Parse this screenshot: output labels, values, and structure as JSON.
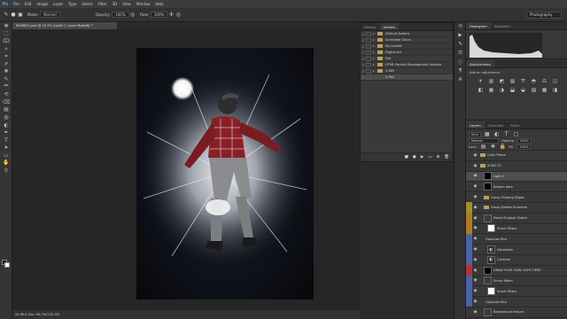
{
  "app": {
    "logo": "Ps"
  },
  "menu": [
    "File",
    "Edit",
    "Image",
    "Layer",
    "Type",
    "Select",
    "Filter",
    "3D",
    "View",
    "Window",
    "Help"
  ],
  "options": {
    "mode_label": "Mode:",
    "mode_value": "Normal",
    "opacity_label": "Opacity:",
    "opacity_value": "100%",
    "flow_label": "Flow:",
    "flow_value": "100%",
    "workspace": "Photography"
  },
  "document": {
    "tab_title": "8349621.psd @ 24.7% (Light 2, Layer Mask/8) *",
    "status": "24.69%   Doc: 66.7M/135.5M"
  },
  "actions_panel": {
    "tabs": [
      "History",
      "Actions"
    ],
    "rows": [
      {
        "check": "✓",
        "label": "Default Actions",
        "selected": false,
        "type": "folder"
      },
      {
        "check": "✓",
        "label": "Animated Glitch",
        "selected": false,
        "type": "folder"
      },
      {
        "check": "✓",
        "label": "My bundle",
        "selected": false,
        "type": "folder"
      },
      {
        "check": "✓",
        "label": "Digital Art",
        "selected": false,
        "type": "folder"
      },
      {
        "check": "✓",
        "label": "Fire",
        "selected": false,
        "type": "folder"
      },
      {
        "check": "✓",
        "label": "HTML Portals Development Actions",
        "selected": false,
        "type": "folder"
      },
      {
        "check": "✓",
        "label": "X-RAY",
        "selected": false,
        "type": "folder"
      },
      {
        "check": "✓",
        "label": "X-Ray",
        "selected": true,
        "type": "action"
      }
    ]
  },
  "right_panels": {
    "histogram_tabs": [
      "Histogram",
      "Navigator"
    ],
    "adjustments_title": "Adjustments",
    "adjustments_hint": "Add an adjustment",
    "layers_tabs": [
      "Layers",
      "Channels",
      "Paths"
    ],
    "kind_label": "Kind",
    "blend_mode": "Normal",
    "opacity_label": "Opacity:",
    "opacity_value": "100%",
    "lock_label": "Lock:",
    "fill_label": "Fill:",
    "fill_value": "100%"
  },
  "layers": [
    {
      "name": "Color Filters",
      "band": "",
      "thumb": "folder",
      "selected": false,
      "indent": 0
    },
    {
      "name": "X-RAY FX",
      "band": "",
      "thumb": "folder",
      "selected": false,
      "indent": 0
    },
    {
      "name": "Light 2",
      "band": "",
      "thumb": "black",
      "selected": true,
      "indent": 1
    },
    {
      "name": "Bottom dark",
      "band": "",
      "thumb": "black",
      "selected": false,
      "indent": 1
    },
    {
      "name": "Group Glowing Edges",
      "band": "",
      "thumb": "folder",
      "selected": false,
      "indent": 1
    },
    {
      "name": "Group Details Enhancer",
      "band": "#a0902e",
      "thumb": "folder",
      "selected": false,
      "indent": 1
    },
    {
      "name": "Paved Original Object",
      "band": "#b07a20",
      "thumb": "photo",
      "selected": false,
      "indent": 1
    },
    {
      "name": "Smart Filters",
      "band": "#b07a20",
      "thumb": "white",
      "selected": false,
      "indent": 2
    },
    {
      "name": "Gaussian Blur",
      "band": "#4b62a8",
      "thumb": "none",
      "selected": false,
      "indent": 2
    },
    {
      "name": "Saturation",
      "band": "#4b62a8",
      "thumb": "adj",
      "selected": false,
      "indent": 2
    },
    {
      "name": "Contrast",
      "band": "#4b62a8",
      "thumb": "adj",
      "selected": false,
      "indent": 2
    },
    {
      "name": "DRAW YOUR OWN LIGHT HERE",
      "band": "#b03434",
      "thumb": "black",
      "selected": false,
      "indent": 1
    },
    {
      "name": "Smart filters",
      "band": "#4b62a8",
      "thumb": "photo",
      "selected": false,
      "indent": 1
    },
    {
      "name": "Smart Filters",
      "band": "#4b62a8",
      "thumb": "white",
      "selected": false,
      "indent": 2
    },
    {
      "name": "Gaussian Blur",
      "band": "#4b62a8",
      "thumb": "none",
      "selected": false,
      "indent": 2
    },
    {
      "name": "Background texture",
      "band": "",
      "thumb": "photo",
      "selected": false,
      "indent": 1
    },
    {
      "name": "Effects",
      "band": "",
      "thumb": "none",
      "selected": false,
      "indent": 2
    }
  ],
  "icons": {
    "tools": [
      "move-icon",
      "marquee-icon",
      "lasso-icon",
      "quick-select-icon",
      "crop-icon",
      "eyedropper-icon",
      "healing-icon",
      "brush-icon",
      "stamp-icon",
      "history-brush-icon",
      "eraser-icon",
      "gradient-icon",
      "blur-icon",
      "dodge-icon",
      "pen-icon",
      "type-icon",
      "path-select-icon",
      "shape-icon",
      "hand-icon",
      "zoom-icon"
    ]
  }
}
